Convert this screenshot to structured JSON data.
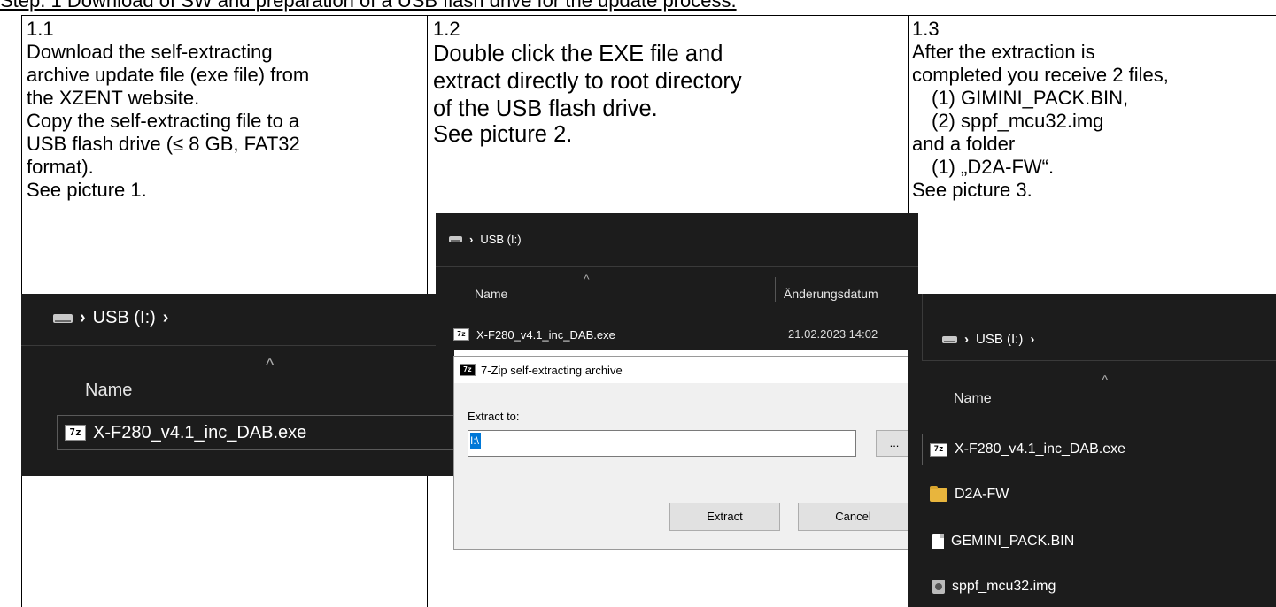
{
  "heading": "Step. 1 Download of SW and preparation of a USB flash drive for the update process.",
  "col1": {
    "num": "1.1",
    "lines": [
      "Download the self-extracting",
      "archive update file (exe file) from",
      "the XZENT website.",
      "Copy the self-extracting file to a",
      "USB flash drive (≤ 8 GB, FAT32",
      "format).",
      "See picture 1."
    ],
    "shot": {
      "breadcrumb": "USB (I:)",
      "name_header": "Name",
      "file": "X-F280_v4.1_inc_DAB.exe"
    }
  },
  "col2": {
    "num": "1.2",
    "lines": [
      "Double click the EXE file and",
      "extract directly to root directory",
      "of the USB flash drive."
    ],
    "see": "See picture 2.",
    "shot": {
      "breadcrumb": "USB (I:)",
      "name_header": "Name",
      "date_header": "Änderungsdatum",
      "file": "X-F280_v4.1_inc_DAB.exe",
      "file_date": "21.02.2023 14:02",
      "dialog_title": "7-Zip self-extracting archive",
      "extract_label": "Extract to:",
      "extract_value": "I:\\",
      "browse_label": "...",
      "extract_button": "Extract",
      "cancel_button": "Cancel",
      "close_glyph": "×"
    }
  },
  "col3": {
    "num": "1.3",
    "lines": [
      "After the extraction is",
      "completed you receive 2 files,"
    ],
    "files": [
      "(1)  GIMINI_PACK.BIN,",
      "(2)  sppf_mcu32.img"
    ],
    "mid": "and a folder",
    "folder": "(1)  „D2A-FW“.",
    "see": "See picture 3.",
    "shot": {
      "breadcrumb": "USB (I:)",
      "name_header": "Name",
      "items": [
        "X-F280_v4.1_inc_DAB.exe",
        "D2A-FW",
        "GEMINI_PACK.BIN",
        "sppf_mcu32.img"
      ]
    }
  },
  "icons": {
    "sevenzip_glyph": "7z",
    "chevron": "›",
    "sort_caret": "^"
  }
}
